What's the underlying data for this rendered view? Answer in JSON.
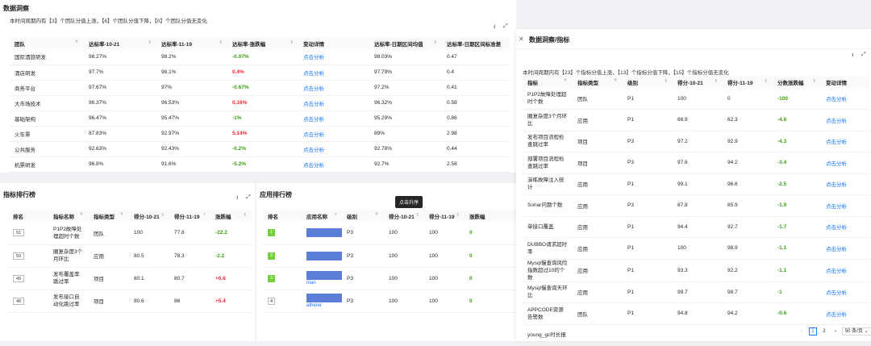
{
  "insight": {
    "title": "数据洞察",
    "summary": "本时间周期内有【3】个团队分值上涨，【6】个团队分值下降，【0】个团队分值无变化",
    "columns": [
      "团队",
      "达标率-10-21",
      "达标率-11-19",
      "达标率-涨跌幅",
      "变动详情",
      "达标率-日期区间均值",
      "达标率-日期区间标准差"
    ],
    "rows": [
      {
        "team": "国际酒旅研发",
        "a": "98.27%",
        "b": "98.2%",
        "c": "-0.07%",
        "dir": "down",
        "link": "点击分析",
        "mean": "98.03%",
        "std": "0.47"
      },
      {
        "team": "酒店研发",
        "a": "97.7%",
        "b": "98.1%",
        "c": "0.4%",
        "dir": "up",
        "link": "点击分析",
        "mean": "97.79%",
        "std": "0.4"
      },
      {
        "team": "商务平台",
        "a": "97.67%",
        "b": "97%",
        "c": "-0.67%",
        "dir": "down",
        "link": "点击分析",
        "mean": "97.2%",
        "std": "0.41"
      },
      {
        "team": "大市场技术",
        "a": "96.37%",
        "b": "96.53%",
        "c": "0.16%",
        "dir": "up",
        "link": "点击分析",
        "mean": "96.32%",
        "std": "0.58"
      },
      {
        "team": "基础架构",
        "a": "96.47%",
        "b": "95.47%",
        "c": "-1%",
        "dir": "down",
        "link": "点击分析",
        "mean": "95.29%",
        "std": "0.86"
      },
      {
        "team": "火车票",
        "a": "87.83%",
        "b": "92.97%",
        "c": "5.14%",
        "dir": "up",
        "link": "点击分析",
        "mean": "89%",
        "std": "2.98"
      },
      {
        "team": "公共服务",
        "a": "92.63%",
        "b": "92.43%",
        "c": "-0.2%",
        "dir": "down",
        "link": "点击分析",
        "mean": "92.78%",
        "std": "0.44"
      },
      {
        "team": "机票研发",
        "a": "96.8%",
        "b": "91.6%",
        "c": "-5.2%",
        "dir": "down",
        "link": "点击分析",
        "mean": "92.7%",
        "std": "2.58"
      }
    ]
  },
  "metric_rank": {
    "title": "指标排行榜",
    "columns": [
      "排名",
      "指标名称",
      "指标类型",
      "得分-10-21",
      "得分-11-19",
      "涨跌幅"
    ],
    "rows": [
      {
        "rank": "51",
        "name": "P1P2故障处理超时个数",
        "type": "团队",
        "a": "100",
        "b": "77.8",
        "c": "-22.2",
        "dir": "down"
      },
      {
        "rank": "50",
        "name": "圈复杂度3个月环比",
        "type": "应用",
        "a": "80.5",
        "b": "78.3",
        "c": "-2.2",
        "dir": "down"
      },
      {
        "rank": "49",
        "name": "发布覆盖率跳过率",
        "type": "项目",
        "a": "80.1",
        "b": "80.7",
        "c": "+0.6",
        "dir": "up"
      },
      {
        "rank": "48",
        "name": "发布接口自动化跳过率",
        "type": "项目",
        "a": "80.6",
        "b": "86",
        "c": "+5.4",
        "dir": "up"
      }
    ]
  },
  "app_rank": {
    "title": "应用排行榜",
    "tooltip": "点击升序",
    "columns": [
      "排名",
      "应用名称",
      "级别",
      "得分-10-21",
      "得分-11-19",
      "涨跌幅"
    ],
    "rows": [
      {
        "rank": "1",
        "name": "",
        "level": "P3",
        "a": "100",
        "b": "100",
        "c": "0"
      },
      {
        "rank": "2",
        "name": "",
        "level": "P3",
        "a": "100",
        "b": "100",
        "c": "0"
      },
      {
        "rank": "3",
        "name": "man",
        "level": "P3",
        "a": "100",
        "b": "100",
        "c": "0"
      },
      {
        "rank": "4",
        "name": "atherer",
        "level": "P3",
        "a": "100",
        "b": "100",
        "c": "0"
      }
    ]
  },
  "drawer": {
    "title": "数据洞察/指标",
    "summary": "本时间周期内有【23】个指标分值上涨，【13】个指标分值下降，【15】个指标分值无变化",
    "columns": [
      "指标",
      "指标类型",
      "级别",
      "得分-10-21",
      "得分-11-19",
      "分数涨跌幅",
      "变动详情"
    ],
    "rows": [
      {
        "name": "P1P2故障处理超时个数",
        "type": "团队",
        "level": "P1",
        "a": "100",
        "b": "0",
        "c": "-100",
        "link": "点击分析"
      },
      {
        "name": "圈复杂度3个月环比",
        "type": "应用",
        "level": "P1",
        "a": "66.9",
        "b": "62.3",
        "c": "-4.6",
        "link": "点击分析"
      },
      {
        "name": "发布项目流程检查跳过率",
        "type": "项目",
        "level": "P3",
        "a": "97.2",
        "b": "92.9",
        "c": "-4.3",
        "link": "点击分析"
      },
      {
        "name": "部署项目流程检查跳过率",
        "type": "项目",
        "level": "P3",
        "a": "97.6",
        "b": "94.2",
        "c": "-3.4",
        "link": "点击分析"
      },
      {
        "name": "演练故障注入统计",
        "type": "应用",
        "level": "P1",
        "a": "99.1",
        "b": "96.6",
        "c": "-2.5",
        "link": "点击分析"
      },
      {
        "name": "Sonar问题个数",
        "type": "应用",
        "level": "P3",
        "a": "87.8",
        "b": "85.9",
        "c": "-1.9",
        "link": "点击分析"
      },
      {
        "name": "单接口覆盖",
        "type": "应用",
        "level": "P1",
        "a": "94.4",
        "b": "92.7",
        "c": "-1.7",
        "link": "点击分析"
      },
      {
        "name": "DUBBO请求超时率",
        "type": "应用",
        "level": "P1",
        "a": "100",
        "b": "98.9",
        "c": "-1.1",
        "link": "点击分析"
      },
      {
        "name": "Mysql慢查询风险指数超过10的个数",
        "type": "应用",
        "level": "P1",
        "a": "93.3",
        "b": "92.2",
        "c": "-1.1",
        "link": "点击分析"
      },
      {
        "name": "Mysql慢查询天环比",
        "type": "应用",
        "level": "P1",
        "a": "99.7",
        "b": "98.7",
        "c": "-1",
        "link": "点击分析"
      },
      {
        "name": "APPCODE资源告警数",
        "type": "团队",
        "level": "P1",
        "a": "94.8",
        "b": "94.2",
        "c": "-0.6",
        "link": "点击分析"
      },
      {
        "name": "young_gc时长报",
        "type": "",
        "level": "",
        "a": "",
        "b": "",
        "c": "",
        "link": ""
      }
    ],
    "pagination": {
      "pages": [
        "1",
        "2"
      ],
      "current": "1",
      "page_size": "50 条/页"
    }
  },
  "watermark": "jenny.chen"
}
